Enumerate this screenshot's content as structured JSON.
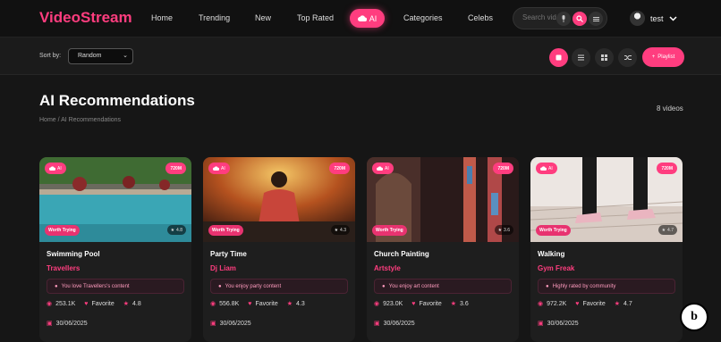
{
  "nav": {
    "logo": "VideoStream",
    "links": [
      "Home",
      "Trending",
      "New",
      "Top Rated",
      "AI",
      "Categories",
      "Celebs"
    ],
    "search_placeholder": "Search vid",
    "user": "test"
  },
  "toolbar": {
    "sort_label": "Sort by:",
    "sort_value": "Random",
    "playlist_label": "Playlist"
  },
  "page": {
    "title": "AI Recommendations",
    "breadcrumb": "Home / AI Recommendations",
    "count": "8 videos"
  },
  "cards": [
    {
      "title": "Swimming Pool",
      "channel": "Travellers",
      "reason": "You love Travellers's content",
      "views": "253.1K",
      "fav": "Favorite",
      "rating": "4.8",
      "thumb_rating": "4.8",
      "date": "30/06/2025",
      "quality": "720M",
      "ai": "AI",
      "tag": "Worth Trying"
    },
    {
      "title": "Party Time",
      "channel": "Dj Liam",
      "reason": "You enjoy party content",
      "views": "556.8K",
      "fav": "Favorite",
      "rating": "4.3",
      "thumb_rating": "4.3",
      "date": "30/06/2025",
      "quality": "720M",
      "ai": "AI",
      "tag": "Worth Trying"
    },
    {
      "title": "Church Painting",
      "channel": "Artstyle",
      "reason": "You enjoy art content",
      "views": "923.0K",
      "fav": "Favorite",
      "rating": "3.6",
      "thumb_rating": "3.6",
      "date": "30/06/2025",
      "quality": "720M",
      "ai": "AI",
      "tag": "Worth Trying"
    },
    {
      "title": "Walking",
      "channel": "Gym Freak",
      "reason": "Highly rated by community",
      "views": "972.2K",
      "fav": "Favorite",
      "rating": "4.7",
      "thumb_rating": "4.7",
      "date": "30/06/2025",
      "quality": "720M",
      "ai": "AI",
      "tag": "Worth Trying"
    }
  ],
  "colors": {
    "accent": "#ff3d7f",
    "bg": "#161616",
    "nav": "#111111"
  }
}
